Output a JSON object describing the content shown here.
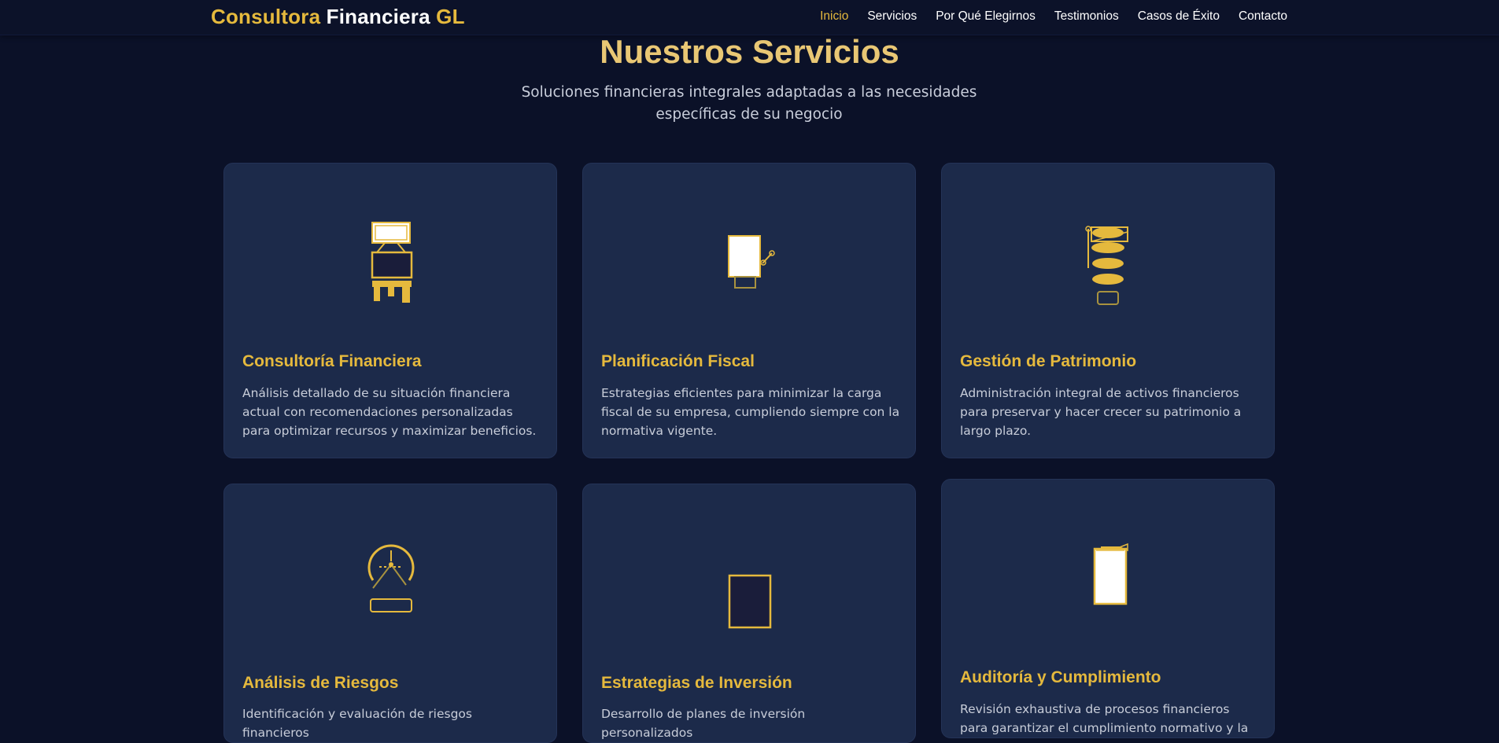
{
  "header": {
    "logo": {
      "part1": "Consultora",
      "part2": "Financiera",
      "part3": "GL"
    },
    "nav": [
      {
        "label": "Inicio",
        "active": true
      },
      {
        "label": "Servicios",
        "active": false
      },
      {
        "label": "Por Qué Elegirnos",
        "active": false
      },
      {
        "label": "Testimonios",
        "active": false
      },
      {
        "label": "Casos de Éxito",
        "active": false
      },
      {
        "label": "Contacto",
        "active": false
      }
    ]
  },
  "services": {
    "title": "Nuestros Servicios",
    "subtitle": "Soluciones financieras integrales adaptadas a las necesidades específicas de su negocio",
    "cards": [
      {
        "icon": "financial-consulting-icon",
        "title": "Consultoría Financiera",
        "description": "Análisis detallado de su situación financiera actual con recomendaciones personalizadas para optimizar recursos y maximizar beneficios."
      },
      {
        "icon": "tax-document-icon",
        "title": "Planificación Fiscal",
        "description": "Estrategias eficientes para minimizar la carga fiscal de su empresa, cumpliendo siempre con la normativa vigente."
      },
      {
        "icon": "coin-stack-icon",
        "title": "Gestión de Patrimonio",
        "description": "Administración integral de activos financieros para preservar y hacer crecer su patrimonio a largo plazo."
      },
      {
        "icon": "risk-gauge-icon",
        "title": "Análisis de Riesgos",
        "description": "Identificación y evaluación de riesgos financieros"
      },
      {
        "icon": "investment-chart-icon",
        "title": "Estrategias de Inversión",
        "description": "Desarrollo de planes de inversión personalizados"
      },
      {
        "icon": "audit-clipboard-icon",
        "title": "Auditoría y Cumplimiento",
        "description": "Revisión exhaustiva de procesos financieros para garantizar el cumplimiento normativo y la"
      }
    ]
  },
  "colors": {
    "background": "#0b1128",
    "card": "#1c2a4a",
    "accent": "#e5b93d",
    "title": "#e9c774"
  }
}
